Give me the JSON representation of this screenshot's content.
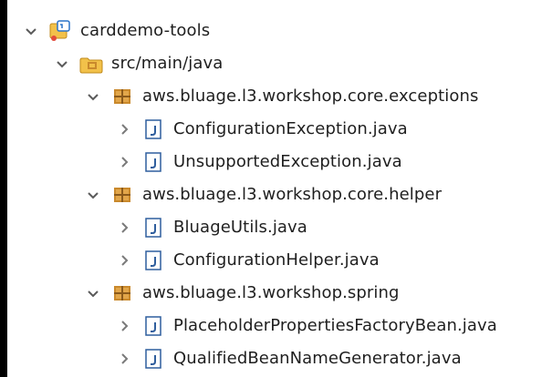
{
  "package_explorer": {
    "project": {
      "name": "carddemo-tools",
      "icon": "java-project-icon",
      "expanded": true
    },
    "source_folder": {
      "name": "src/main/java",
      "icon": "source-folder-icon",
      "expanded": true
    },
    "packages": [
      {
        "name": "aws.bluage.l3.workshop.core.exceptions",
        "icon": "package-icon",
        "expanded": true,
        "files": [
          {
            "name": "ConfigurationException.java",
            "icon": "java-file-icon"
          },
          {
            "name": "UnsupportedException.java",
            "icon": "java-file-icon"
          }
        ]
      },
      {
        "name": "aws.bluage.l3.workshop.core.helper",
        "icon": "package-icon",
        "expanded": true,
        "files": [
          {
            "name": "BluageUtils.java",
            "icon": "java-file-icon"
          },
          {
            "name": "ConfigurationHelper.java",
            "icon": "java-file-icon"
          }
        ]
      },
      {
        "name": "aws.bluage.l3.workshop.spring",
        "icon": "package-icon",
        "expanded": true,
        "files": [
          {
            "name": "PlaceholderPropertiesFactoryBean.java",
            "icon": "java-file-icon"
          },
          {
            "name": "QualifiedBeanNameGenerator.java",
            "icon": "java-file-icon"
          }
        ]
      }
    ]
  },
  "colors": {
    "chevron": "#5a5a5a",
    "package_fill": "#c9892c",
    "java_file_fill": "#2f5e9d",
    "folder_fill": "#f2c14a",
    "project_fill": "#2a73c9",
    "text": "#1f1f1f"
  }
}
